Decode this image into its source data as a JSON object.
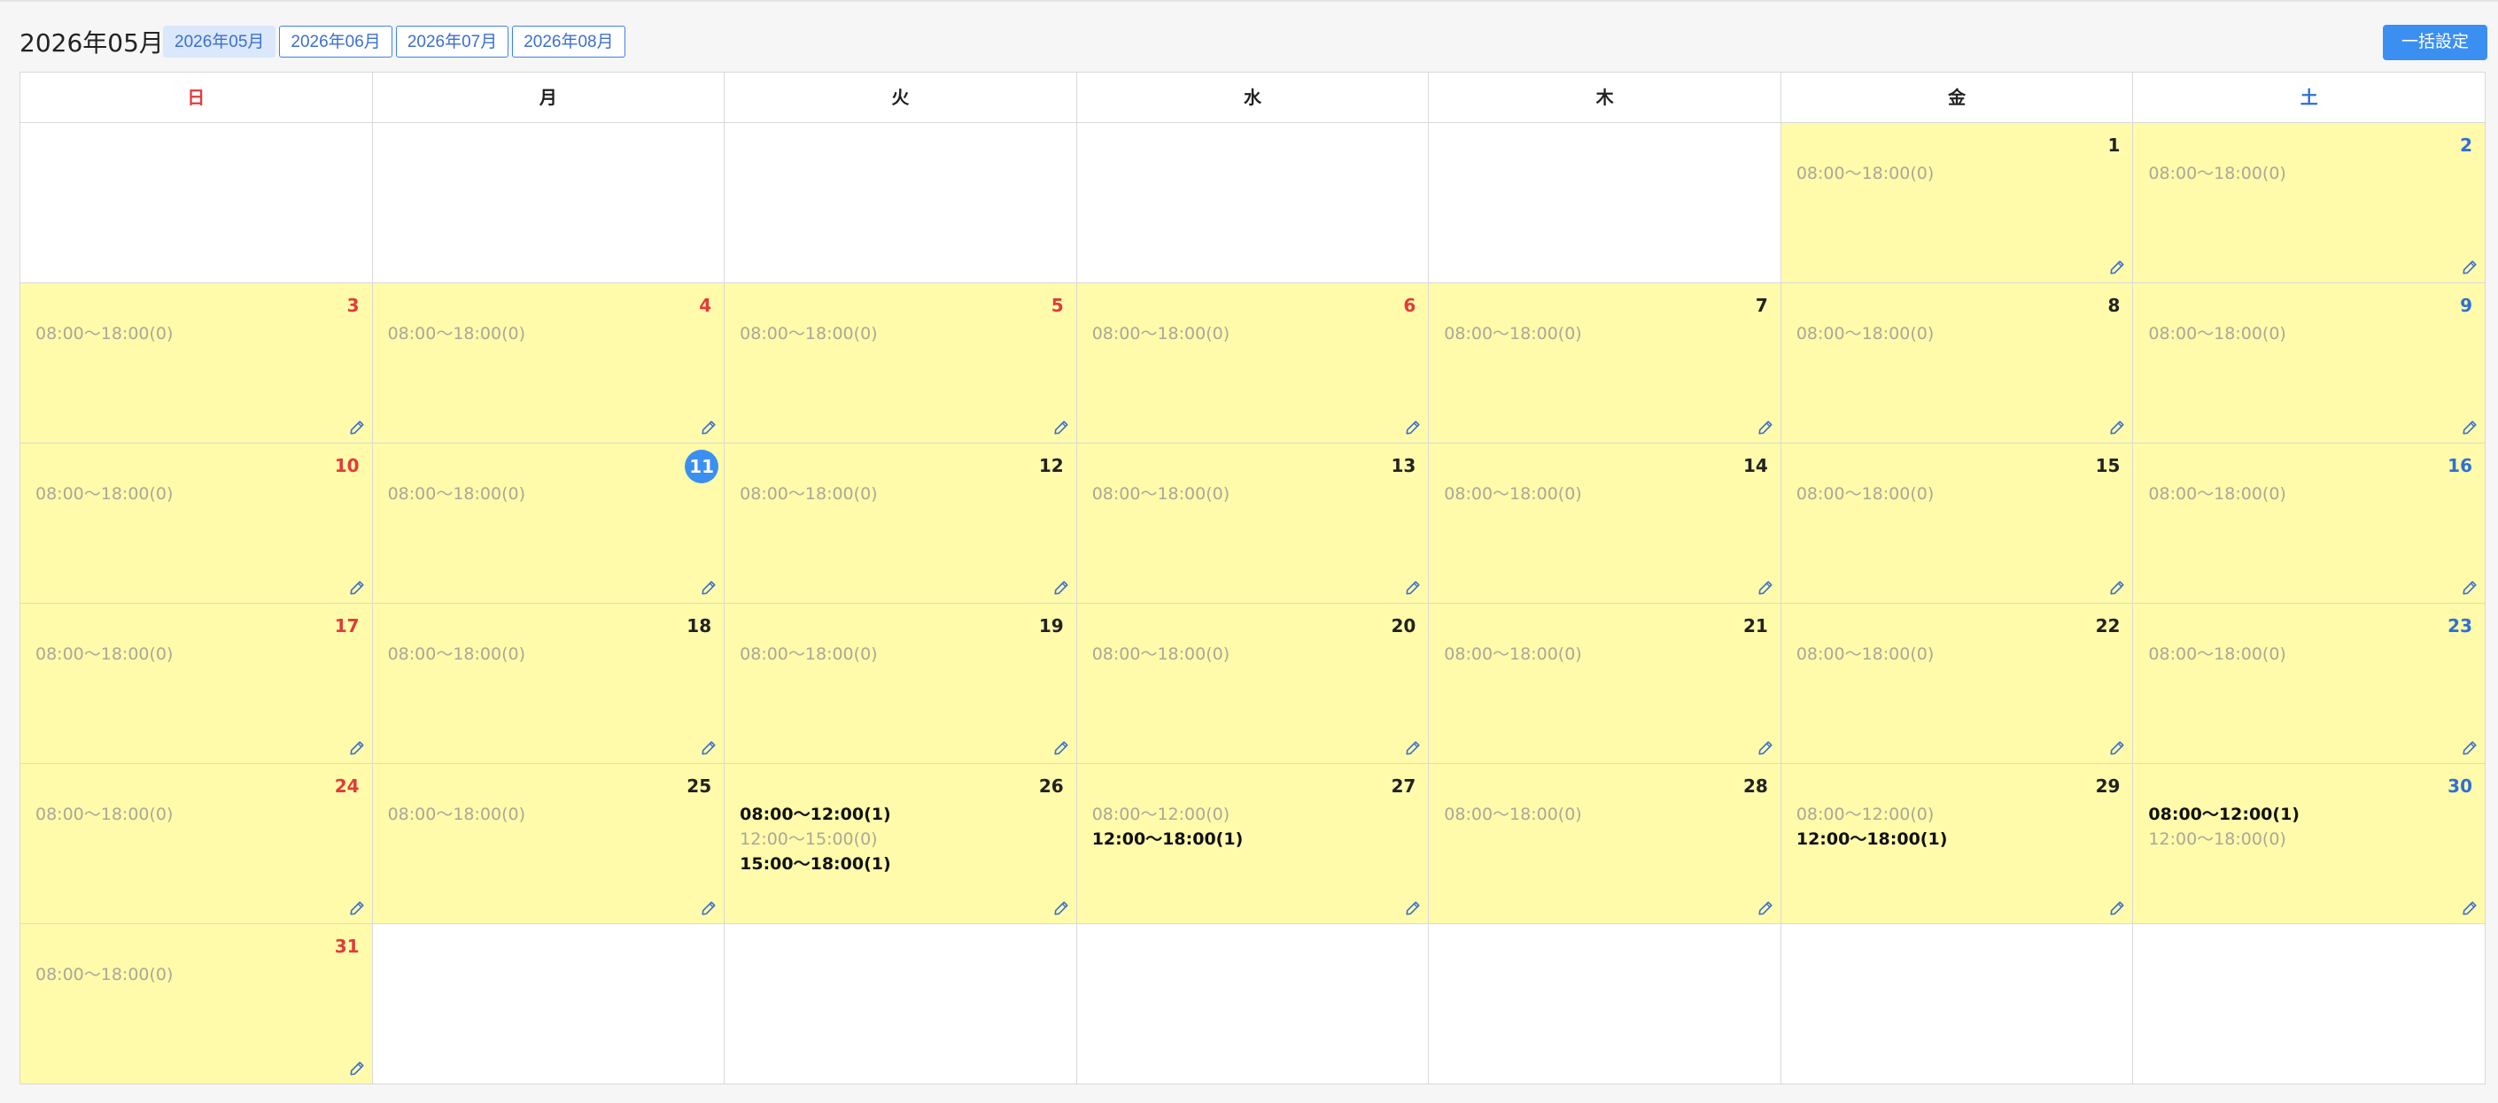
{
  "header": {
    "current_month": "2026年05月",
    "month_tabs": [
      "2026年05月",
      "2026年06月",
      "2026年07月",
      "2026年08月"
    ],
    "bulk_button": "一括設定"
  },
  "weekdays": [
    "日",
    "月",
    "火",
    "水",
    "木",
    "金",
    "土"
  ],
  "weeks": [
    [
      null,
      null,
      null,
      null,
      null,
      {
        "day": "1",
        "slots": [
          {
            "text": "08:00〜18:00(0)",
            "booked": false
          }
        ]
      },
      {
        "day": "2",
        "slots": [
          {
            "text": "08:00〜18:00(0)",
            "booked": false
          }
        ]
      }
    ],
    [
      {
        "day": "3",
        "slots": [
          {
            "text": "08:00〜18:00(0)",
            "booked": false
          }
        ]
      },
      {
        "day": "4",
        "holiday": true,
        "slots": [
          {
            "text": "08:00〜18:00(0)",
            "booked": false
          }
        ]
      },
      {
        "day": "5",
        "holiday": true,
        "slots": [
          {
            "text": "08:00〜18:00(0)",
            "booked": false
          }
        ]
      },
      {
        "day": "6",
        "holiday": true,
        "slots": [
          {
            "text": "08:00〜18:00(0)",
            "booked": false
          }
        ]
      },
      {
        "day": "7",
        "slots": [
          {
            "text": "08:00〜18:00(0)",
            "booked": false
          }
        ]
      },
      {
        "day": "8",
        "slots": [
          {
            "text": "08:00〜18:00(0)",
            "booked": false
          }
        ]
      },
      {
        "day": "9",
        "slots": [
          {
            "text": "08:00〜18:00(0)",
            "booked": false
          }
        ]
      }
    ],
    [
      {
        "day": "10",
        "slots": [
          {
            "text": "08:00〜18:00(0)",
            "booked": false
          }
        ]
      },
      {
        "day": "11",
        "today": true,
        "slots": [
          {
            "text": "08:00〜18:00(0)",
            "booked": false
          }
        ]
      },
      {
        "day": "12",
        "slots": [
          {
            "text": "08:00〜18:00(0)",
            "booked": false
          }
        ]
      },
      {
        "day": "13",
        "slots": [
          {
            "text": "08:00〜18:00(0)",
            "booked": false
          }
        ]
      },
      {
        "day": "14",
        "slots": [
          {
            "text": "08:00〜18:00(0)",
            "booked": false
          }
        ]
      },
      {
        "day": "15",
        "slots": [
          {
            "text": "08:00〜18:00(0)",
            "booked": false
          }
        ]
      },
      {
        "day": "16",
        "slots": [
          {
            "text": "08:00〜18:00(0)",
            "booked": false
          }
        ]
      }
    ],
    [
      {
        "day": "17",
        "slots": [
          {
            "text": "08:00〜18:00(0)",
            "booked": false
          }
        ]
      },
      {
        "day": "18",
        "slots": [
          {
            "text": "08:00〜18:00(0)",
            "booked": false
          }
        ]
      },
      {
        "day": "19",
        "slots": [
          {
            "text": "08:00〜18:00(0)",
            "booked": false
          }
        ]
      },
      {
        "day": "20",
        "slots": [
          {
            "text": "08:00〜18:00(0)",
            "booked": false
          }
        ]
      },
      {
        "day": "21",
        "slots": [
          {
            "text": "08:00〜18:00(0)",
            "booked": false
          }
        ]
      },
      {
        "day": "22",
        "slots": [
          {
            "text": "08:00〜18:00(0)",
            "booked": false
          }
        ]
      },
      {
        "day": "23",
        "slots": [
          {
            "text": "08:00〜18:00(0)",
            "booked": false
          }
        ]
      }
    ],
    [
      {
        "day": "24",
        "slots": [
          {
            "text": "08:00〜18:00(0)",
            "booked": false
          }
        ]
      },
      {
        "day": "25",
        "slots": [
          {
            "text": "08:00〜18:00(0)",
            "booked": false
          }
        ]
      },
      {
        "day": "26",
        "slots": [
          {
            "text": "08:00〜12:00(1)",
            "booked": true
          },
          {
            "text": "12:00〜15:00(0)",
            "booked": false
          },
          {
            "text": "15:00〜18:00(1)",
            "booked": true
          }
        ]
      },
      {
        "day": "27",
        "slots": [
          {
            "text": "08:00〜12:00(0)",
            "booked": false
          },
          {
            "text": "12:00〜18:00(1)",
            "booked": true
          }
        ]
      },
      {
        "day": "28",
        "slots": [
          {
            "text": "08:00〜18:00(0)",
            "booked": false
          }
        ]
      },
      {
        "day": "29",
        "slots": [
          {
            "text": "08:00〜12:00(0)",
            "booked": false
          },
          {
            "text": "12:00〜18:00(1)",
            "booked": true
          }
        ]
      },
      {
        "day": "30",
        "slots": [
          {
            "text": "08:00〜12:00(1)",
            "booked": true
          },
          {
            "text": "12:00〜18:00(0)",
            "booked": false
          }
        ]
      }
    ],
    [
      {
        "day": "31",
        "slots": [
          {
            "text": "08:00〜18:00(0)",
            "booked": false
          }
        ]
      },
      null,
      null,
      null,
      null,
      null,
      null
    ]
  ],
  "colors": {
    "sunday": "#e23b3b",
    "saturday": "#2f6fd6",
    "available_day_bg": "#fffbaa",
    "accent": "#3b8ff0"
  },
  "icons": {
    "edit": "pencil-icon"
  }
}
